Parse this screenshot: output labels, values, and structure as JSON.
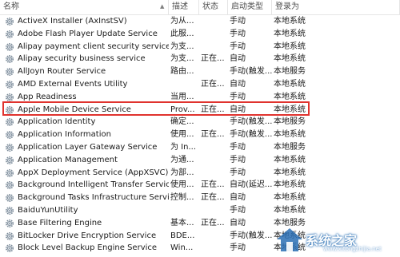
{
  "columns": {
    "name": "名称",
    "description": "描述",
    "status": "状态",
    "startup_type": "启动类型",
    "logon_as": "登录为"
  },
  "services": [
    {
      "name": "ActiveX Installer (AxInstSV)",
      "description": "为从...",
      "status": "",
      "startup_type": "手动",
      "logon_as": "本地系统"
    },
    {
      "name": "Adobe Flash Player Update Service",
      "description": "此服...",
      "status": "",
      "startup_type": "手动",
      "logon_as": "本地系统"
    },
    {
      "name": "Alipay payment client security service",
      "description": "为支...",
      "status": "",
      "startup_type": "手动",
      "logon_as": "本地系统"
    },
    {
      "name": "Alipay security business service",
      "description": "为支...",
      "status": "正在...",
      "startup_type": "自动",
      "logon_as": "本地系统"
    },
    {
      "name": "AllJoyn Router Service",
      "description": "路由...",
      "status": "",
      "startup_type": "手动(触发...",
      "logon_as": "本地服务"
    },
    {
      "name": "AMD External Events Utility",
      "description": "",
      "status": "正在...",
      "startup_type": "自动",
      "logon_as": "本地系统"
    },
    {
      "name": "App Readiness",
      "description": "当用...",
      "status": "",
      "startup_type": "手动",
      "logon_as": "本地系统"
    },
    {
      "name": "Apple Mobile Device Service",
      "description": "Prov...",
      "status": "正在...",
      "startup_type": "自动",
      "logon_as": "本地系统"
    },
    {
      "name": "Application Identity",
      "description": "确定...",
      "status": "",
      "startup_type": "手动(触发...",
      "logon_as": "本地服务"
    },
    {
      "name": "Application Information",
      "description": "使用...",
      "status": "正在...",
      "startup_type": "手动(触发...",
      "logon_as": "本地系统"
    },
    {
      "name": "Application Layer Gateway Service",
      "description": "为 In...",
      "status": "",
      "startup_type": "手动",
      "logon_as": "本地服务"
    },
    {
      "name": "Application Management",
      "description": "为通...",
      "status": "",
      "startup_type": "手动",
      "logon_as": "本地系统"
    },
    {
      "name": "AppX Deployment Service (AppXSVC)",
      "description": "为部...",
      "status": "",
      "startup_type": "手动",
      "logon_as": "本地系统"
    },
    {
      "name": "Background Intelligent Transfer Service",
      "description": "使用...",
      "status": "正在...",
      "startup_type": "自动(延迟...",
      "logon_as": "本地系统"
    },
    {
      "name": "Background Tasks Infrastructure Service",
      "description": "控制...",
      "status": "正在...",
      "startup_type": "自动",
      "logon_as": "本地系统"
    },
    {
      "name": "BaiduYunUtility",
      "description": "",
      "status": "",
      "startup_type": "手动",
      "logon_as": "本地系统"
    },
    {
      "name": "Base Filtering Engine",
      "description": "基本...",
      "status": "正在...",
      "startup_type": "自动",
      "logon_as": "本地服务"
    },
    {
      "name": "BitLocker Drive Encryption Service",
      "description": "BDE...",
      "status": "",
      "startup_type": "手动(触发...",
      "logon_as": "本地系统"
    },
    {
      "name": "Block Level Backup Engine Service",
      "description": "Win...",
      "status": "",
      "startup_type": "手动",
      "logon_as": "本地系统"
    }
  ],
  "highlighted_service": "Apple Mobile Device Service",
  "watermark": {
    "text": "系统之家",
    "url": "www.xitongzhijia.net"
  },
  "colors": {
    "highlight_border": "#e0332e",
    "gear_icon": "#7a8a99",
    "watermark_glow": "#2a6fb4"
  }
}
